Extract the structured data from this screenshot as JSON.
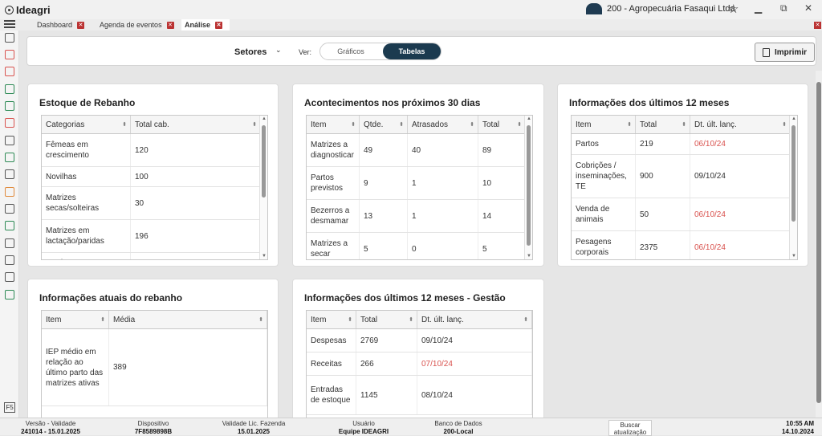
{
  "app": {
    "logo_text": "Ideagri",
    "farm": "200 - Agropecuária Fasaqui Ltda",
    "win_min": "▁",
    "win_max": "⧉",
    "win_close": "✕"
  },
  "tabs": [
    {
      "label": "Dashboard"
    },
    {
      "label": "Agenda de eventos"
    },
    {
      "label": "Análise"
    }
  ],
  "toolbar": {
    "setores": "Setores",
    "ver_label": "Ver:",
    "option_graficos": "Gráficos",
    "option_tabelas": "Tabelas",
    "print_label": "Imprimir"
  },
  "cards": {
    "estoque": {
      "title": "Estoque de Rebanho",
      "headers": [
        "Categorias",
        "Total cab."
      ],
      "rows": [
        [
          "Fêmeas em crescimento",
          "120"
        ],
        [
          "Novilhas",
          "100"
        ],
        [
          "Matrizes secas/solteiras",
          "30"
        ],
        [
          "Matrizes em lactação/paridas",
          "196"
        ],
        [
          "Machos em",
          ""
        ]
      ]
    },
    "acontecimentos": {
      "title": "Acontecimentos nos próximos 30 dias",
      "headers": [
        "Item",
        "Qtde.",
        "Atrasados",
        "Total"
      ],
      "rows": [
        [
          "Matrizes a diagnosticar",
          "49",
          "40",
          "89"
        ],
        [
          "Partos previstos",
          "9",
          "1",
          "10"
        ],
        [
          "Bezerros a desmamar",
          "13",
          "1",
          "14"
        ],
        [
          "Matrizes a secar",
          "5",
          "0",
          "5"
        ]
      ]
    },
    "info12": {
      "title": "Informações dos últimos 12 meses",
      "headers": [
        "Item",
        "Total",
        "Dt. últ. lanç."
      ],
      "rows": [
        [
          "Partos",
          "219",
          "06/10/24"
        ],
        [
          "Cobrições / inseminações, TE",
          "900",
          "09/10/24"
        ],
        [
          "Venda de animais",
          "50",
          "06/10/24"
        ],
        [
          "Pesagens corporais",
          "2375",
          "06/10/24"
        ]
      ]
    },
    "atuais": {
      "title": "Informações atuais do rebanho",
      "headers": [
        "Item",
        "Média"
      ],
      "rows": [
        [
          "IEP médio em relação ao último parto das matrizes ativas",
          "389"
        ]
      ]
    },
    "gestao": {
      "title": "Informações dos últimos 12 meses - Gestão",
      "headers": [
        "Item",
        "Total",
        "Dt. últ. lanç."
      ],
      "rows": [
        [
          "Despesas",
          "2769",
          "09/10/24"
        ],
        [
          "Receitas",
          "266",
          "07/10/24"
        ],
        [
          "Entradas de estoque",
          "1145",
          "08/10/24"
        ]
      ]
    }
  },
  "status": {
    "versao_label": "Versão - Validade",
    "versao": "241014 - 15.01.2025",
    "dispositivo_label": "Dispositivo",
    "dispositivo": "7F8589898B",
    "validade_label": "Validade Lic. Fazenda",
    "validade": "15.01.2025",
    "usuario_label": "Usuário",
    "usuario": "Equipe IDEAGRI",
    "banco_label": "Banco de Dados",
    "banco": "200-Local",
    "buscar": "Buscar atualização",
    "time": "10:55 AM",
    "date": "14.10.2024"
  },
  "colors": {
    "accent": "#1b3a4f",
    "overdue": "#d9534f",
    "tab_close": "#b33333"
  }
}
